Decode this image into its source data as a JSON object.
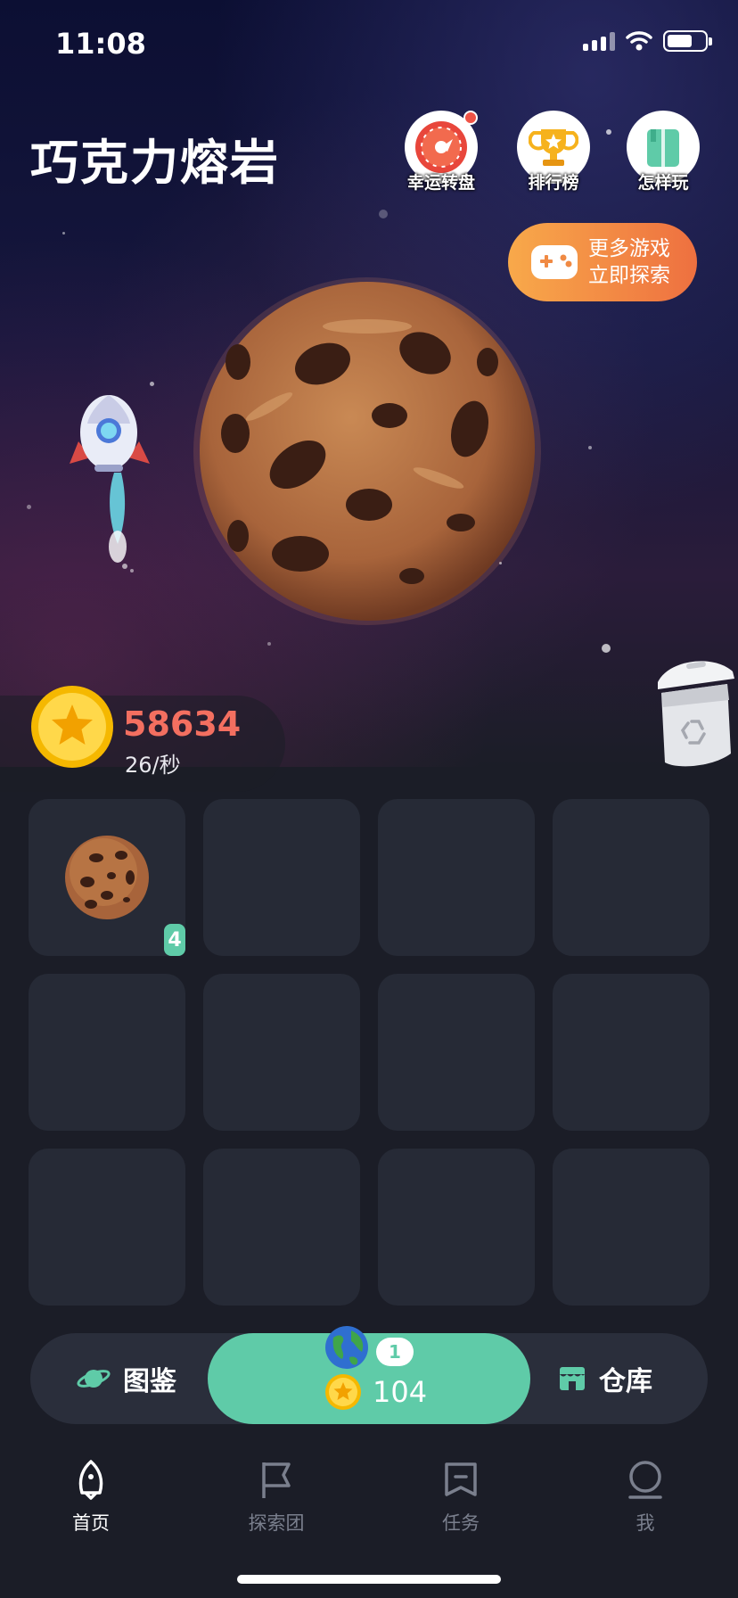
{
  "status_bar": {
    "time": "11:08"
  },
  "header": {
    "title": "巧克力熔岩",
    "buttons": [
      {
        "label": "幸运转盘",
        "icon": "wheel-icon",
        "has_badge": true
      },
      {
        "label": "排行榜",
        "icon": "trophy-icon"
      },
      {
        "label": "怎样玩",
        "icon": "book-icon"
      }
    ]
  },
  "more_games": {
    "line1": "更多游戏",
    "line2": "立即探索",
    "icon": "gamepad-icon"
  },
  "stats": {
    "coins": "58634",
    "rate": "26/秒"
  },
  "grid": {
    "rows": 3,
    "columns": 4,
    "occupied": [
      {
        "index": 0,
        "item": "cookie-planet",
        "level": "4"
      }
    ]
  },
  "actions": {
    "catalog_label": "图鉴",
    "warehouse_label": "仓库",
    "buy_level": "1",
    "buy_cost": "104"
  },
  "tabs": [
    {
      "label": "首页",
      "active": true
    },
    {
      "label": "探索团",
      "active": false
    },
    {
      "label": "任务",
      "active": false
    },
    {
      "label": "我",
      "active": false
    }
  ],
  "colors": {
    "accent": "#5fcba8",
    "score": "#f36f60",
    "more_games_gradient": [
      "#f8a94a",
      "#ee7040"
    ],
    "cell": "#262a36",
    "background": "#1b1d27"
  }
}
